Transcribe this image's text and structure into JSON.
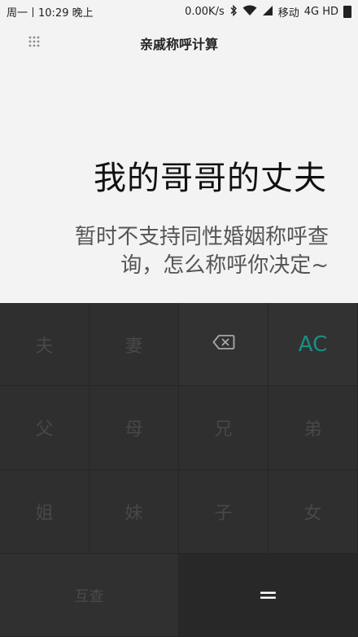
{
  "status": {
    "day": "周一",
    "time": "10:29",
    "period": "晚上",
    "speed": "0.00K/s",
    "carrier": "移动",
    "network": "4G HD"
  },
  "header": {
    "title": "亲戚称呼计算"
  },
  "display": {
    "expression": "我的哥哥的丈夫",
    "result": "暂时不支持同性婚姻称呼查询，怎么称呼你决定~"
  },
  "keys": {
    "husband": "夫",
    "wife": "妻",
    "clear": "AC",
    "father": "父",
    "mother": "母",
    "elder_brother": "兄",
    "younger_brother": "弟",
    "elder_sister": "姐",
    "younger_sister": "妹",
    "son": "子",
    "daughter": "女",
    "mutual": "互查",
    "equals": "="
  },
  "colors": {
    "accent": "#1a8f84",
    "keypad_bg": "#2b2b2b",
    "display_bg": "#f2f3f2"
  }
}
